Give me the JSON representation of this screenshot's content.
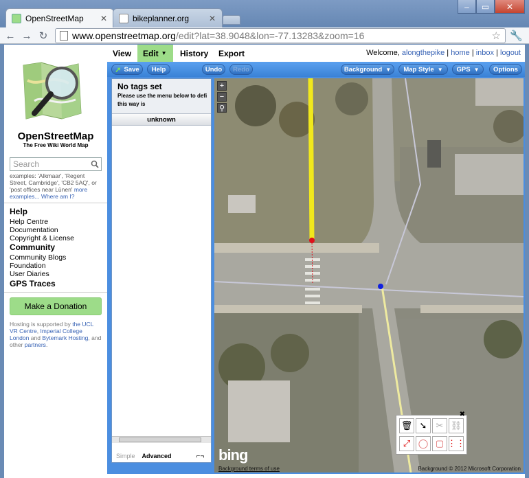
{
  "browser": {
    "tabs": [
      {
        "title": "OpenStreetMap",
        "active": true
      },
      {
        "title": "bikeplanner.org",
        "active": false
      }
    ],
    "url_host": "www.openstreetmap.org",
    "url_rest": "/edit?lat=38.9048&lon=-77.13283&zoom=16"
  },
  "sidebar": {
    "title": "OpenStreetMap",
    "tagline": "The Free Wiki World Map",
    "search_placeholder": "Search",
    "search_hint_pre": "examples: 'Alkmaar', 'Regent Street, Cambridge', 'CB2 5AQ', or 'post offices near Lünen'",
    "search_hint_link": "more examples...",
    "where_am_i": "Where am I?",
    "help_heading": "Help",
    "help_items": [
      "Help Centre",
      "Documentation",
      "Copyright & License"
    ],
    "community_heading": "Community",
    "community_items": [
      "Community Blogs",
      "Foundation",
      "User Diaries"
    ],
    "gps_traces": "GPS Traces",
    "donate": "Make a Donation",
    "hosting_pre": "Hosting is supported by",
    "hosting_ucl": "the UCL VR Centre",
    "hosting_comma1": ",",
    "hosting_imperial": "Imperial College London",
    "hosting_and": "and",
    "hosting_bytemark": "Bytemark Hosting",
    "hosting_other": ", and other",
    "hosting_partners": "partners",
    "hosting_end": "."
  },
  "main_tabs": {
    "view": "View",
    "edit": "Edit",
    "history": "History",
    "export": "Export"
  },
  "user": {
    "welcome": "Welcome,",
    "username": "alongthepike",
    "home": "home",
    "inbox": "inbox",
    "logout": "logout",
    "sep": "|"
  },
  "editor": {
    "save": "Save",
    "help": "Help",
    "undo": "Undo",
    "redo": "Redo",
    "background": "Background",
    "map_style": "Map Style",
    "gps": "GPS",
    "options": "Options",
    "panel_title": "No tags set",
    "panel_desc_1": "Please use the menu below to defi",
    "panel_desc_2": "this way is",
    "preset": "unknown",
    "mode_simple": "Simple",
    "mode_advanced": "Advanced",
    "bing": "bing",
    "background_terms": "Background terms of use",
    "copyright": "Background © 2012 Microsoft Corporation"
  },
  "colors": {
    "osm_green": "#9ddc89",
    "editor_blue": "#4b8ee0",
    "link_blue": "#3863b5",
    "selected_way": "#f1e81c",
    "node_red": "#e0101a",
    "node_blue": "#1020e0"
  },
  "icons": [
    "search-icon",
    "star-icon",
    "wrench-icon",
    "save-icon",
    "trash-icon",
    "arrow-icon",
    "scissors-icon",
    "link-icon",
    "straighten-icon",
    "circularise-icon",
    "square-icon",
    "parallel-icon"
  ]
}
